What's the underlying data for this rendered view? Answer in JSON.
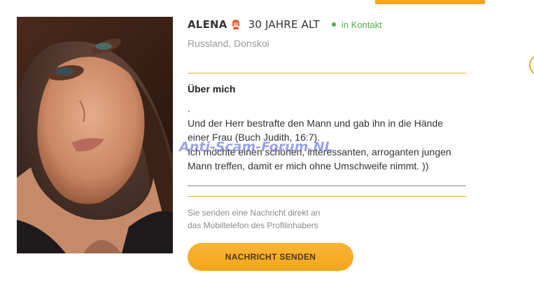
{
  "profile": {
    "name": "ALENA",
    "age": "30 JAHRE ALT",
    "status": "in Kontakt",
    "location": "Russland, Donskoi",
    "gender_icon": "female-icon",
    "photo_icon": "profile-photo"
  },
  "about": {
    "heading": "Über mich",
    "text": ".\nUnd der Herr bestrafte den Mann und gab ihn in die Hände einer Frau (Buch Judith, 16:7).\nIch möchte einen schönen, interessanten, arroganten jungen Mann treffen, damit er mich ohne Umschweife nimmt. ))"
  },
  "watermark": "Anti-Scam-Forum.NL",
  "message_info": {
    "line1": "Sie senden eine Nachricht direkt an",
    "line2": "das Mobiltelefon des Profilinhabers"
  },
  "send_button": {
    "label": "NACHRICHT SENDEN"
  },
  "colors": {
    "accent": "#f6a51c",
    "status": "#4caf50",
    "divider": "#e8a93a",
    "watermark": "#465ad2"
  }
}
